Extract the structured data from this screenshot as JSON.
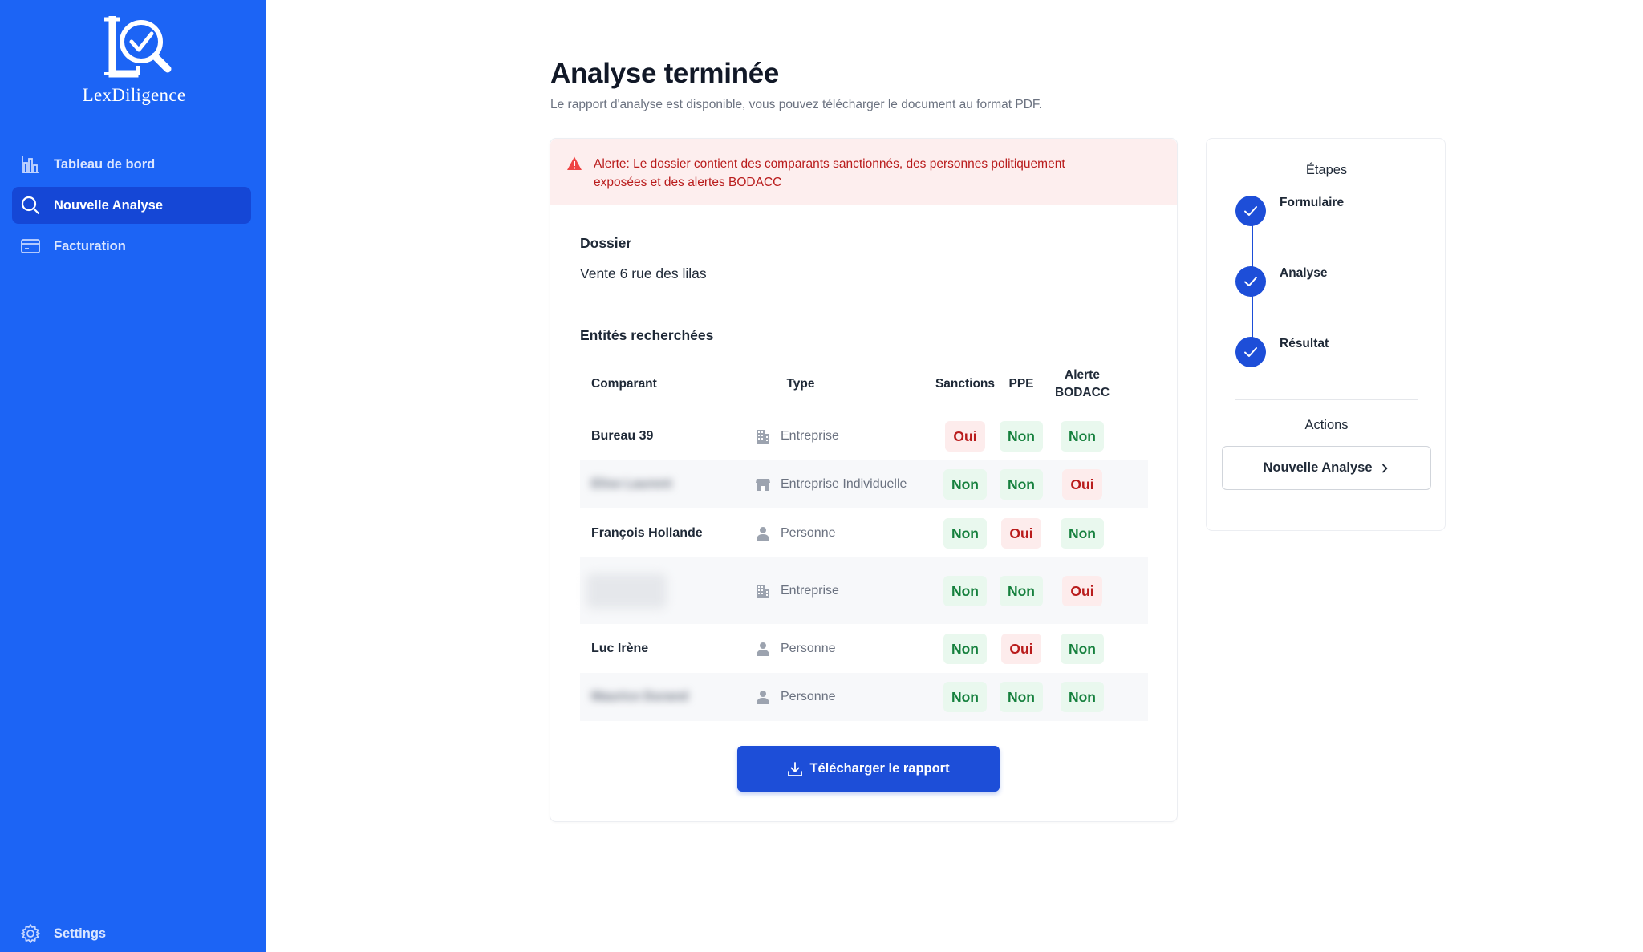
{
  "brand": {
    "name": "LexDiligence"
  },
  "sidebar": {
    "items": [
      {
        "label": "Tableau de bord",
        "icon": "chart-icon"
      },
      {
        "label": "Nouvelle Analyse",
        "icon": "search-icon",
        "active": true
      },
      {
        "label": "Facturation",
        "icon": "credit-card-icon"
      }
    ],
    "settings_label": "Settings"
  },
  "page": {
    "title": "Analyse terminée",
    "subtitle": "Le rapport d'analyse est disponible, vous pouvez télécharger le document au format PDF."
  },
  "alert": {
    "text": "Alerte: Le dossier contient des comparants sanctionnés, des personnes politiquement exposées et des alertes BODACC"
  },
  "dossier": {
    "label": "Dossier",
    "value": "Vente 6 rue des lilas"
  },
  "entities": {
    "label": "Entités recherchées",
    "columns": {
      "comparant": "Comparant",
      "type": "Type",
      "sanctions": "Sanctions",
      "ppe": "PPE",
      "alert_line1": "Alerte",
      "alert_line2": "BODACC"
    },
    "rows": [
      {
        "name": "Bureau 39",
        "type": "Entreprise",
        "type_icon": "building-icon",
        "sanctions": "Oui",
        "ppe": "Non",
        "alert": "Non"
      },
      {
        "name": "Elise Laurent",
        "type": "Entreprise Individuelle",
        "type_icon": "store-icon",
        "sanctions": "Non",
        "ppe": "Non",
        "alert": "Oui"
      },
      {
        "name": "François Hollande",
        "type": "Personne",
        "type_icon": "person-icon",
        "sanctions": "Non",
        "ppe": "Oui",
        "alert": "Non"
      },
      {
        "name": "",
        "type": "Entreprise",
        "type_icon": "building-icon",
        "sanctions": "Non",
        "ppe": "Non",
        "alert": "Oui"
      },
      {
        "name": "Luc Irène",
        "type": "Personne",
        "type_icon": "person-icon",
        "sanctions": "Non",
        "ppe": "Oui",
        "alert": "Non"
      },
      {
        "name": "Maurice Durand",
        "type": "Personne",
        "type_icon": "person-icon",
        "sanctions": "Non",
        "ppe": "Non",
        "alert": "Non"
      }
    ]
  },
  "download_button": {
    "label": "Télécharger le rapport",
    "icon": "download-icon"
  },
  "steps": {
    "title": "Étapes",
    "items": [
      {
        "label": "Formulaire",
        "done": true
      },
      {
        "label": "Analyse",
        "done": true
      },
      {
        "label": "Résultat",
        "done": true
      }
    ],
    "actions_title": "Actions",
    "new_analysis_label": "Nouvelle Analyse"
  },
  "colors": {
    "sidebar_bg": "#1c64f5",
    "primary": "#1d4ed8",
    "alert_bg": "#fdeeee",
    "alert_text": "#b91c1c",
    "success_bg": "#e9f8ee",
    "success_text": "#15803d"
  }
}
